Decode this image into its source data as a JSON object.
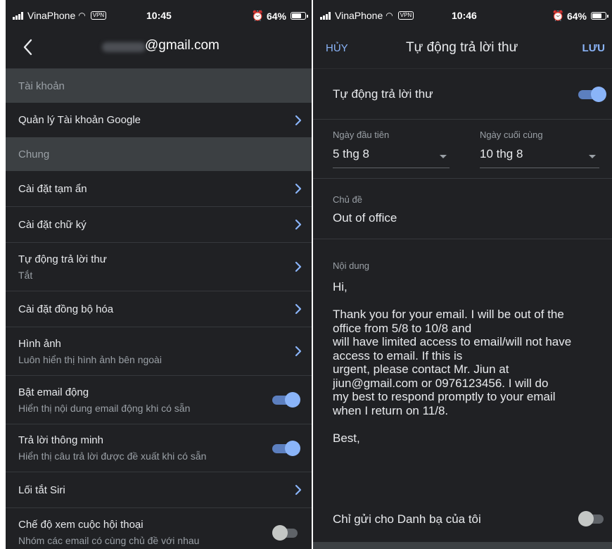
{
  "left_screen": {
    "status": {
      "carrier": "VinaPhone",
      "vpn": "VPN",
      "time": "10:45",
      "battery": "64%"
    },
    "header": {
      "email_visible": "@gmail.com"
    },
    "sections": [
      {
        "heading": "Tài khoản",
        "items": [
          {
            "title": "Quản lý Tài khoản Google"
          }
        ]
      },
      {
        "heading": "Chung",
        "items": [
          {
            "title": "Cài đặt tạm ẩn"
          },
          {
            "title": "Cài đặt chữ ký"
          },
          {
            "title": "Tự động trả lời thư",
            "subtitle": "Tắt"
          },
          {
            "title": "Cài đặt đồng bộ hóa"
          },
          {
            "title": "Hình ảnh",
            "subtitle": "Luôn hiển thị hình ảnh bên ngoài"
          },
          {
            "title": "Bật email động",
            "subtitle": "Hiển thị nội dung email động khi có sẵn",
            "toggle": true
          },
          {
            "title": "Trả lời thông minh",
            "subtitle": "Hiển thị câu trả lời được đề xuất khi có sẵn",
            "toggle": true
          },
          {
            "title": "Lối tắt Siri"
          },
          {
            "title": "Chế độ xem cuộc hội thoại",
            "subtitle": "Nhóm các email có cùng chủ đề với nhau",
            "toggle": false
          }
        ]
      }
    ]
  },
  "right_screen": {
    "status": {
      "carrier": "VinaPhone",
      "vpn": "VPN",
      "time": "10:46",
      "battery": "64%"
    },
    "header": {
      "cancel": "HỦY",
      "title": "Tự động trả lời thư",
      "save": "LƯU"
    },
    "auto_reply": {
      "label": "Tự động trả lời thư",
      "enabled": true
    },
    "first_day": {
      "label": "Ngày đầu tiên",
      "value": "5 thg 8"
    },
    "last_day": {
      "label": "Ngày cuối cùng",
      "value": "10 thg 8"
    },
    "subject": {
      "label": "Chủ đề",
      "value": "Out of office"
    },
    "body": {
      "label": "Nội dung",
      "text": "Hi,\n\nThank you for your email. I will be out of the\noffice from 5/8 to 10/8 and\nwill have limited access to email/will not have\naccess to email. If this is\nurgent, please contact Mr. Jiun at\njiun@gmail.com or 0976123456. I will do\nmy best to respond promptly to your email\nwhen I return on 11/8.\n\nBest,"
    },
    "contacts_only": {
      "label": "Chỉ gửi cho Danh bạ của tôi",
      "enabled": false
    }
  },
  "colors": {
    "background": "#202124",
    "section": "#3c4043",
    "accent": "#8ab4f8",
    "text": "#e8eaed",
    "secondary": "#9aa0a6"
  },
  "icons": [
    "back-chevron-icon",
    "chevron-right-icon",
    "wifi-icon",
    "signal-icon",
    "alarm-icon",
    "battery-icon",
    "dropdown-caret-icon"
  ]
}
